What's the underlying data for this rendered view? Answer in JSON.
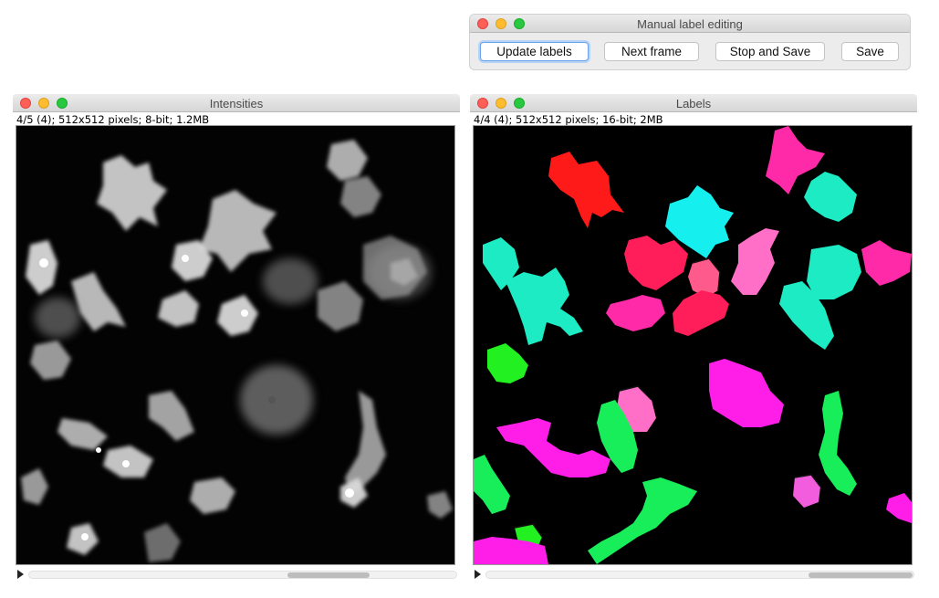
{
  "panel": {
    "title": "Manual label editing",
    "buttons": {
      "update": "Update labels",
      "next": "Next frame",
      "stop_save": "Stop and Save",
      "save": "Save"
    }
  },
  "intensities": {
    "title": "Intensities",
    "info": "4/5 (4); 512x512 pixels; 8-bit; 1.2MB"
  },
  "labels": {
    "title": "Labels",
    "info": "4/4 (4); 512x512 pixels; 16-bit; 2MB"
  },
  "colors": {
    "red": "#ff1a1a",
    "cyan": "#15f0ee",
    "teal": "#1cebc4",
    "green": "#18ee5a",
    "lime": "#22f020",
    "pink": "#ff1f8c",
    "hotpink": "#ff2aa8",
    "magenta": "#ff1ee8",
    "lightpink": "#ff6fc8",
    "orchid": "#f25ddd",
    "crimson": "#ff1e5a",
    "rose": "#ff5a8c"
  }
}
